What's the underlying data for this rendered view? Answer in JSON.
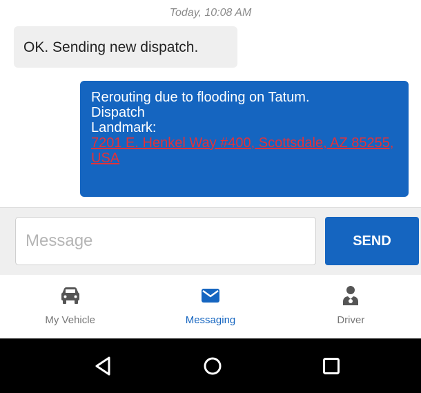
{
  "chat": {
    "timestamp": "Today, 10:08 AM",
    "incoming_message": "OK. Sending new dispatch.",
    "outgoing": {
      "line1": "Rerouting due to flooding on Tatum.",
      "line2": "Dispatch",
      "line3": "Landmark:",
      "address": "7201 E. Henkel Way #400, Scottsdale, AZ 85255, USA"
    }
  },
  "composer": {
    "placeholder": "Message",
    "send_label": "SEND"
  },
  "tabs": [
    {
      "label": "My Vehicle",
      "icon": "car-icon"
    },
    {
      "label": "Messaging",
      "icon": "envelope-icon"
    },
    {
      "label": "Driver",
      "icon": "person-icon"
    }
  ],
  "active_tab": "Messaging",
  "system_nav": {
    "back": "back-icon",
    "home": "home-icon",
    "recents": "recents-icon"
  },
  "colors": {
    "accent": "#1565c0",
    "incoming_bubble": "#efefef",
    "address_link": "#e0323a",
    "tab_inactive": "#777777",
    "navbar": "#000000"
  }
}
